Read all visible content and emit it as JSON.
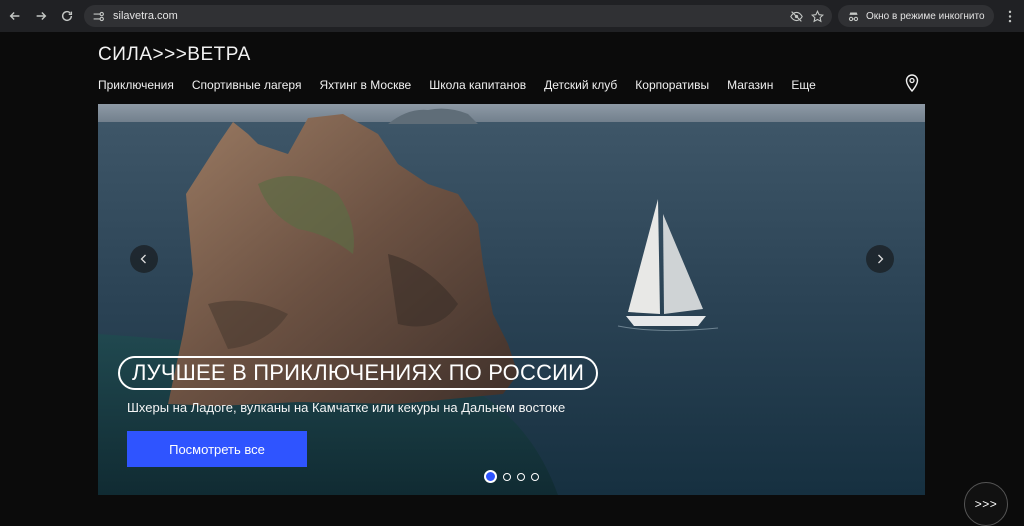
{
  "browser": {
    "url": "silavetra.com",
    "incognito_label": "Окно в режиме инкогнито"
  },
  "site": {
    "logo": "СИЛА>>>ВЕТРА",
    "nav": [
      "Приключения",
      "Спортивные лагеря",
      "Яхтинг в Москве",
      "Школа капитанов",
      "Детский клуб",
      "Корпоративы",
      "Магазин",
      "Еще"
    ]
  },
  "hero": {
    "title": "ЛУЧШЕЕ В ПРИКЛЮЧЕНИЯХ ПО РОССИИ",
    "subtitle": "Шхеры на Ладоге, вулканы на Камчатке или кекуры на Дальнем востоке",
    "cta_label": "Посмотреть все",
    "slide_count": 4,
    "active_slide": 1
  },
  "floating_button_label": ">>>",
  "colors": {
    "accent": "#2f54ff",
    "background": "#0b0b0b"
  }
}
